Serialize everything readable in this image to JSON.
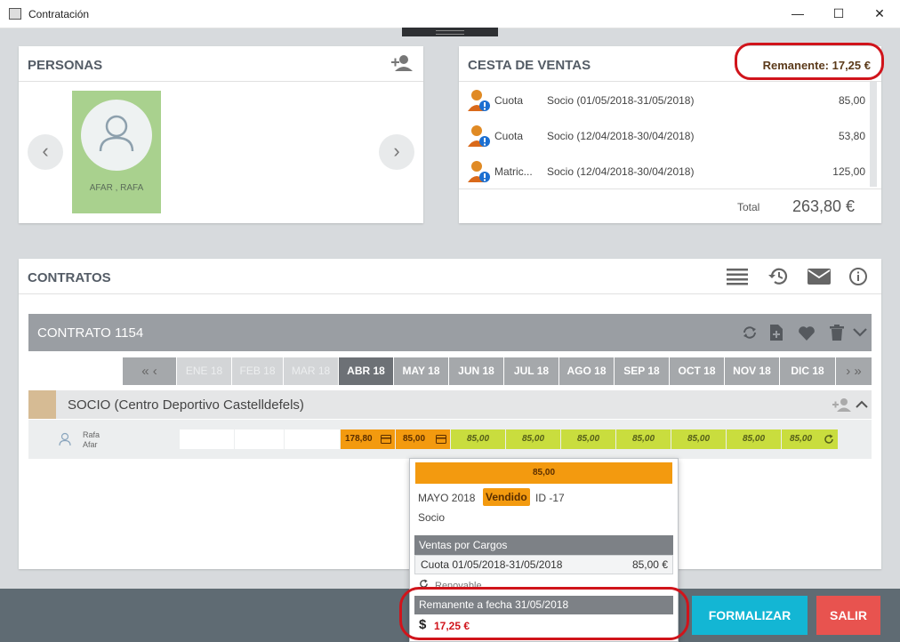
{
  "window": {
    "title": "Contratación",
    "minimize": "—",
    "maximize": "☐",
    "close": "✕"
  },
  "personas": {
    "title": "PERSONAS",
    "person_name": "AFAR , RAFA",
    "prev": "‹",
    "next": "›"
  },
  "cesta": {
    "title": "CESTA DE VENTAS",
    "remanente": "Remanente: 17,25 €",
    "items": [
      {
        "concept": "Cuota",
        "desc": "Socio (01/05/2018-31/05/2018)",
        "amount": "85,00"
      },
      {
        "concept": "Cuota",
        "desc": "Socio (12/04/2018-30/04/2018)",
        "amount": "53,80"
      },
      {
        "concept": "Matric...",
        "desc": "Socio (12/04/2018-30/04/2018)",
        "amount": "125,00"
      }
    ],
    "total_label": "Total",
    "total_value": "263,80 €"
  },
  "contratos": {
    "title": "CONTRATOS",
    "contract_title": "CONTRATO 1154",
    "months": [
      "ENE 18",
      "FEB 18",
      "MAR 18",
      "ABR 18",
      "MAY 18",
      "JUN 18",
      "JUL 18",
      "AGO 18",
      "SEP 18",
      "OCT 18",
      "NOV 18",
      "DIC 18"
    ],
    "socio_title": "SOCIO (Centro Deportivo Castelldefels)",
    "member_first": "Rafa",
    "member_last": "Afar",
    "cells": [
      "",
      "",
      "",
      "178,80",
      "85,00",
      "85,00",
      "85,00",
      "85,00",
      "85,00",
      "85,00",
      "85,00",
      "85,00"
    ]
  },
  "popup": {
    "bar_value": "85,00",
    "month": "MAYO 2018",
    "status": "Vendido",
    "id": "ID -17",
    "type": "Socio",
    "section1": "Ventas por Cargos",
    "line_desc": "Cuota 01/05/2018-31/05/2018",
    "line_amount": "85,00 €",
    "renewable": "Renovable",
    "section2": "Remanente a fecha 31/05/2018",
    "remanente_value": "17,25 €"
  },
  "actions": {
    "formalizar": "FORMALIZAR",
    "salir": "SALIR"
  },
  "colors": {
    "accent": "#13b6d4",
    "danger": "#e8534f",
    "orange": "#f39a0f",
    "green": "#c9dd3e",
    "highlight": "#d0141b"
  }
}
